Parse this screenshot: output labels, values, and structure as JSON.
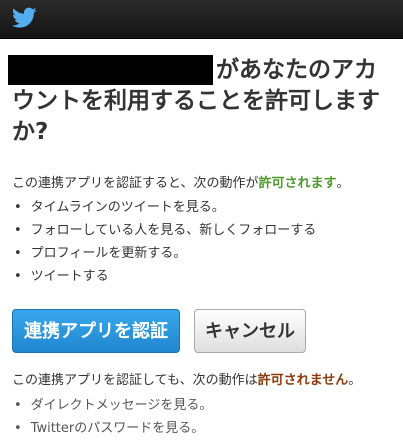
{
  "header": {
    "logo_icon": "twitter-bird-icon"
  },
  "heading": {
    "text_after_redaction": "があなたのアカウントを利用することを許可しますか?"
  },
  "allowed": {
    "intro_prefix": "この連携アプリを認証すると、次の動作が",
    "intro_highlight": "許可されます",
    "intro_suffix": "。",
    "items": [
      "タイムラインのツイートを見る。",
      "フォローしている人を見る、新しくフォローする",
      "プロフィールを更新する。",
      "ツイートする"
    ]
  },
  "buttons": {
    "authorize": "連携アプリを認証",
    "cancel": "キャンセル"
  },
  "denied": {
    "intro_prefix": "この連携アプリを認証しても、次の動作は",
    "intro_highlight": "許可されません",
    "intro_suffix": "。",
    "items": [
      "ダイレクトメッセージを見る。",
      "Twitterのパスワードを見る。"
    ]
  },
  "colors": {
    "allowed": "#4d9a2c",
    "not_allowed": "#8b3a0e",
    "primary_button": "#2b97de"
  }
}
